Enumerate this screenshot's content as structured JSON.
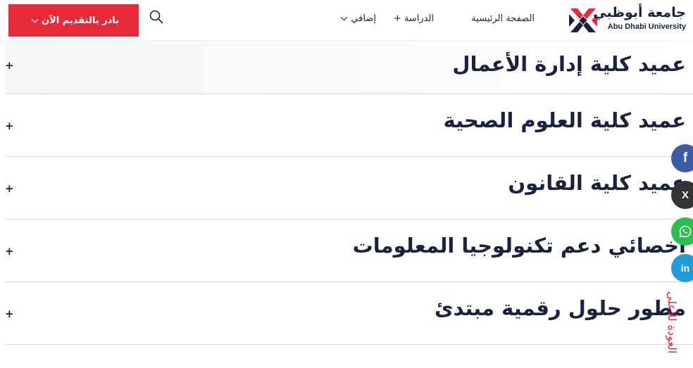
{
  "header": {
    "logo_ar": "جامعة أبوظبي",
    "logo_en": "Abu Dhabi University",
    "nav": {
      "home": "الصفحة الرئيسية",
      "study": "الدراسة +",
      "more": "إضافي"
    },
    "apply_label": "بادر بالتقديم الآن"
  },
  "accordion": [
    {
      "title": "عميد كلية إدارة الأعمال",
      "toggle": "+"
    },
    {
      "title": "عميد كلية العلوم الصحية",
      "toggle": "+"
    },
    {
      "title": "عميد كلية القانون",
      "toggle": "+"
    },
    {
      "title": "اخصائي دعم تكنولوجيا المعلومات",
      "toggle": "+"
    },
    {
      "title": "مطور حلول رقمية مبتدئ",
      "toggle": "+"
    }
  ],
  "share": {
    "facebook": "f",
    "x": "X",
    "linkedin": "in"
  },
  "back_to_top": "العودة للأعلى",
  "colors": {
    "accent": "#e72a3a",
    "navy": "#1a2240",
    "facebook": "#3b5aa8",
    "x": "#333333",
    "whatsapp": "#2bbe4f",
    "linkedin": "#1d9cd8"
  }
}
